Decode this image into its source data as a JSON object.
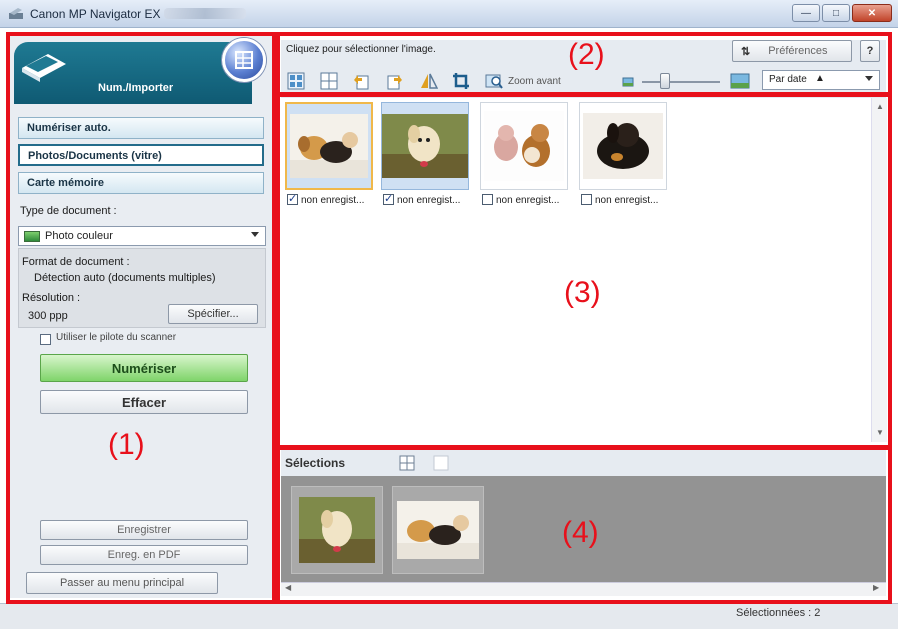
{
  "window": {
    "title": "Canon MP Navigator EX",
    "controls": {
      "minimize": "—",
      "maximize": "□",
      "close": "✕"
    }
  },
  "left_panel": {
    "header_title": "Num./Importer",
    "nav_items": [
      {
        "label": "Numériser auto.",
        "active": false
      },
      {
        "label": "Photos/Documents (vitre)",
        "active": true
      },
      {
        "label": "Carte mémoire",
        "active": false
      }
    ],
    "doc_type_label": "Type de document :",
    "doc_type_value": "Photo couleur",
    "format_label": "Format de document :",
    "format_value": "Détection auto (documents multiples)",
    "resolution_label": "Résolution :",
    "resolution_value": "300 ppp",
    "specify_button": "Spécifier...",
    "scanner_driver_checkbox": "Utiliser le pilote du scanner",
    "scan_button": "Numériser",
    "clear_button": "Effacer",
    "save_button": "Enregistrer",
    "save_pdf_button": "Enreg. en PDF",
    "main_menu_button": "Passer au menu principal"
  },
  "toolbar": {
    "instruction": "Cliquez pour sélectionner l'image.",
    "preferences_button": "Préférences",
    "help_button": "?",
    "zoom_label": "Zoom avant",
    "sort_value": "Par date",
    "sort_arrow": "▲"
  },
  "thumbnails": [
    {
      "caption": "non enregist...",
      "checked": true,
      "selected": true,
      "focused": true,
      "icon": "dogs-photo"
    },
    {
      "caption": "non enregist...",
      "checked": true,
      "selected": true,
      "focused": false,
      "icon": "dog-photo"
    },
    {
      "caption": "non enregist...",
      "checked": false,
      "selected": false,
      "focused": false,
      "icon": "teddy-dog-photo"
    },
    {
      "caption": "non enregist...",
      "checked": false,
      "selected": false,
      "focused": false,
      "icon": "black-dog-photo"
    }
  ],
  "selections": {
    "title": "Sélections",
    "items": [
      "dog-photo",
      "dogs-photo"
    ]
  },
  "status": {
    "selected_count": "Sélectionnées : 2"
  },
  "annotations": {
    "area1": "(1)",
    "area2": "(2)",
    "area3": "(3)",
    "area4": "(4)"
  },
  "colors": {
    "annotation_red": "#e8101b",
    "header_teal": "#1f7a93",
    "scan_green": "#7fd46a"
  }
}
